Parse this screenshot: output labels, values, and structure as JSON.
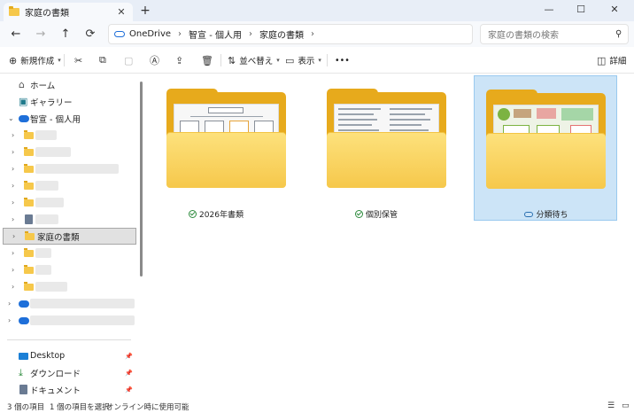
{
  "window": {
    "tab_title": "家庭の書類",
    "tab_close": "✕",
    "new_tab": "+",
    "minimize": "—",
    "maximize": "☐",
    "close": "✕"
  },
  "nav": {
    "back": "←",
    "forward": "→",
    "up": "↑",
    "refresh": "⟳"
  },
  "address": {
    "segments": [
      "OneDrive",
      "智宣 - 個人用",
      "家庭の書類"
    ],
    "sep": "›"
  },
  "search": {
    "placeholder": "家庭の書類の検索",
    "icon": "search-icon"
  },
  "toolbar": {
    "new_label": "新規作成",
    "sort_label": "並べ替え",
    "view_label": "表示",
    "more_label": "•••",
    "details_label": "詳細"
  },
  "sidebar": {
    "home": "ホーム",
    "gallery": "ギャラリー",
    "onedrive": "智宣 - 個人用",
    "selected_folder": "家庭の書類",
    "desktop": "Desktop",
    "downloads": "ダウンロード",
    "documents": "ドキュメント"
  },
  "folders": [
    {
      "name": "2026年書類",
      "status": "synced"
    },
    {
      "name": "個別保管",
      "status": "synced"
    },
    {
      "name": "分類待ち",
      "status": "cloud"
    }
  ],
  "status": {
    "count": "3 個の項目",
    "selected": "1 個の項目を選択",
    "availability": "オンライン時に使用可能"
  },
  "colors": {
    "accent": "#1e6fd9",
    "folder": "#f6c84b",
    "selection": "#cce4f7"
  }
}
